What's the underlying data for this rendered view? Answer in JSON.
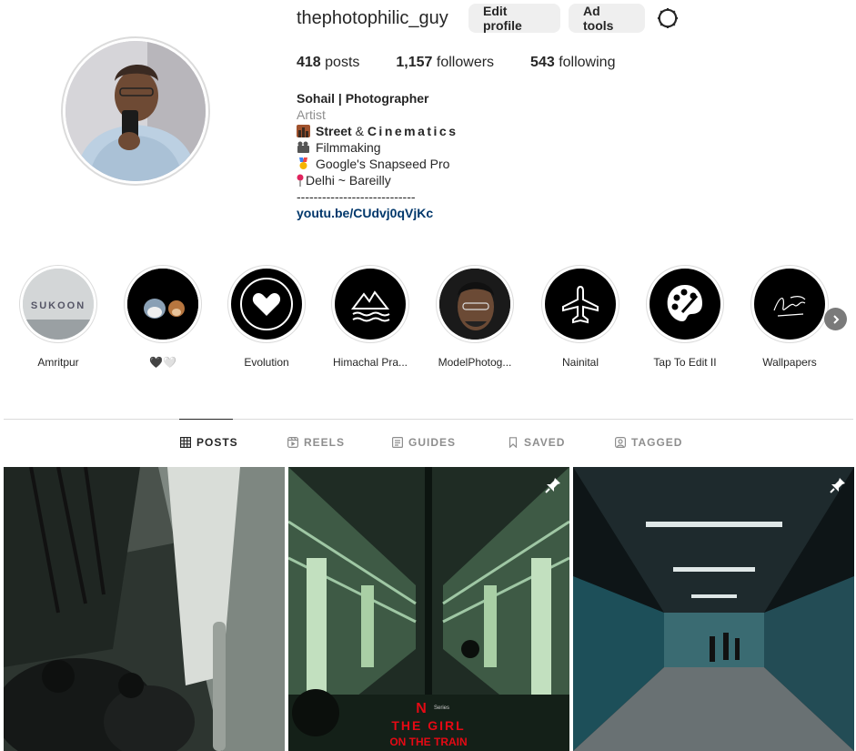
{
  "profile": {
    "username": "thephotophilic_guy",
    "edit_label": "Edit profile",
    "ad_tools_label": "Ad tools",
    "stats": {
      "posts_count": "418",
      "posts_label": "posts",
      "followers_count": "1,157",
      "followers_label": "followers",
      "following_count": "543",
      "following_label": "following"
    },
    "bio": {
      "name": "Sohail | Photographer",
      "category": "Artist",
      "line1_a": "Street",
      "line1_b": " & ",
      "line1_c": "Cinematics",
      "line2": "Filmmaking",
      "line3": "Google's Snapseed Pro",
      "line4": "Delhi ~ Bareilly",
      "line5": "----------------------------",
      "link": "youtu.be/CUdvj0qVjKc"
    }
  },
  "highlights": [
    {
      "label": "Amritpur",
      "cover_text": "SUKOON"
    },
    {
      "label": "🖤🤍"
    },
    {
      "label": "Evolution"
    },
    {
      "label": "Himachal Pra..."
    },
    {
      "label": "ModelPhotog..."
    },
    {
      "label": "Nainital"
    },
    {
      "label": "Tap To Edit II"
    },
    {
      "label": "Wallpapers"
    }
  ],
  "tabs": [
    {
      "label": "POSTS",
      "active": true
    },
    {
      "label": "REELS"
    },
    {
      "label": "GUIDES"
    },
    {
      "label": "SAVED"
    },
    {
      "label": "TAGGED"
    }
  ],
  "posts": [
    {
      "overlay": ""
    },
    {
      "overlay_badge": "N",
      "overlay_series": "Series",
      "overlay_title_1": "THE GIRL",
      "overlay_title_2": "ON THE TRAIN"
    },
    {
      "overlay": ""
    }
  ],
  "colors": {
    "link": "#00376b",
    "muted": "#8e8e8e",
    "button_bg": "#efefef",
    "netflix_red": "#e50914"
  }
}
